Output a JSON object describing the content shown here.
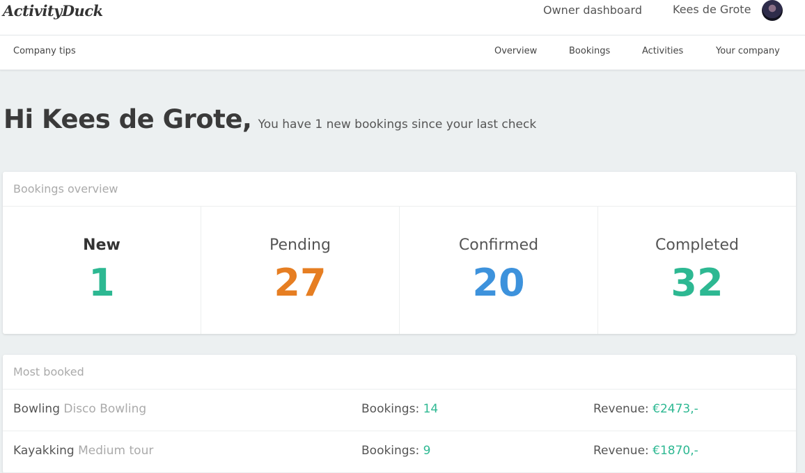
{
  "header": {
    "logo": "ActivityDuck",
    "owner_dashboard": "Owner dashboard",
    "user_name": "Kees de Grote"
  },
  "subnav": {
    "company_tips": "Company tips",
    "items": [
      "Overview",
      "Bookings",
      "Activities",
      "Your company"
    ]
  },
  "greeting": {
    "hello": "Hi Kees de Grote,",
    "message": "You have 1 new bookings since your last check"
  },
  "overview": {
    "title": "Bookings overview",
    "stats": [
      {
        "label": "New",
        "value": "1",
        "color": "#2db892"
      },
      {
        "label": "Pending",
        "value": "27",
        "color": "#e67e22"
      },
      {
        "label": "Confirmed",
        "value": "20",
        "color": "#3d92dc"
      },
      {
        "label": "Completed",
        "value": "32",
        "color": "#2db892"
      }
    ]
  },
  "most_booked": {
    "title": "Most booked",
    "bookings_label": "Bookings:",
    "revenue_label": "Revenue:",
    "rows": [
      {
        "activity": "Bowling",
        "variant": "Disco Bowling",
        "bookings": "14",
        "revenue": "€2473,-"
      },
      {
        "activity": "Kayakking",
        "variant": "Medium tour",
        "bookings": "9",
        "revenue": "€1870,-"
      }
    ]
  }
}
